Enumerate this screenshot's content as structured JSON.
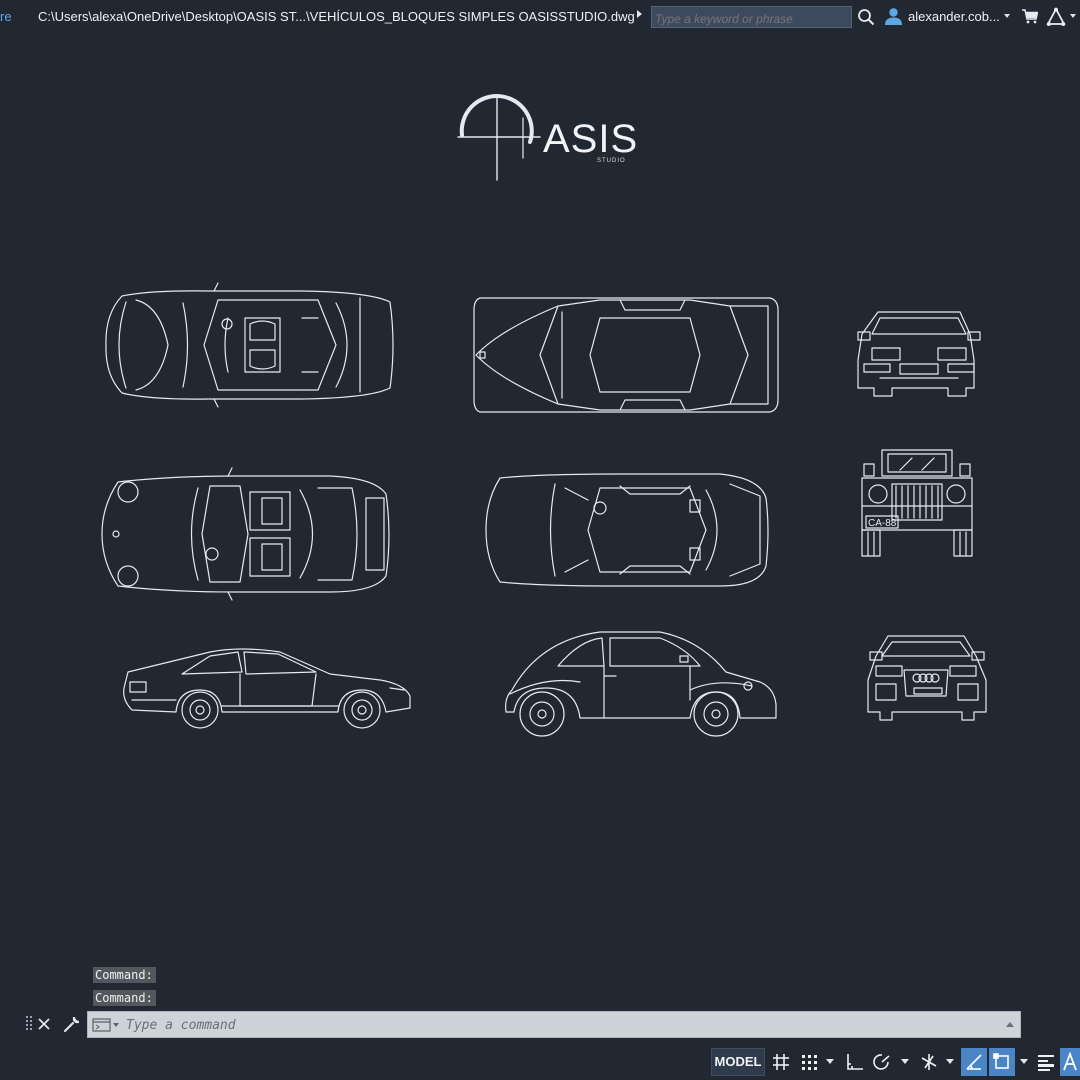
{
  "titlebar": {
    "app_name_clip": "re",
    "file_path": "C:\\Users\\alexa\\OneDrive\\Desktop\\OASIS ST...\\VEHÍCULOS_BLOQUES SIMPLES OASISSTUDIO.dwg",
    "search_placeholder": "Type a keyword or phrase",
    "user_name": "alexander.cob...",
    "icons": [
      "expand-arrow-icon",
      "search-icon",
      "user-icon",
      "cart-icon",
      "autodesk-icon"
    ]
  },
  "drawing": {
    "logo": {
      "text": "ASIS",
      "subtext": "STUDIO"
    },
    "plate_text": "CA-88",
    "blocks": [
      "sports-coupe-top-view",
      "sedan-top-view",
      "car-front-view",
      "convertible-top-view",
      "hatchback-top-view",
      "jeep-front-view",
      "coupe-side-view",
      "beetle-side-view",
      "audi-front-view"
    ]
  },
  "command": {
    "history": [
      "Command:",
      "Command:"
    ],
    "placeholder": "Type a command"
  },
  "statusbar": {
    "model_label": "MODEL",
    "buttons": [
      {
        "name": "grid-display",
        "active": false
      },
      {
        "name": "snap-mode",
        "active": false
      },
      {
        "name": "ortho-mode",
        "active": false
      },
      {
        "name": "polar-tracking",
        "active": false
      },
      {
        "name": "isometric-drafting",
        "active": false
      },
      {
        "name": "object-snap-tracking",
        "active": true
      },
      {
        "name": "object-snap",
        "active": true
      },
      {
        "name": "lineweight",
        "active": false
      },
      {
        "name": "annotation-scale",
        "active": true
      }
    ]
  },
  "colors": {
    "background": "#212832",
    "linework": "#e6eaef",
    "accent": "#4a86c7",
    "link": "#5aa8e6"
  }
}
